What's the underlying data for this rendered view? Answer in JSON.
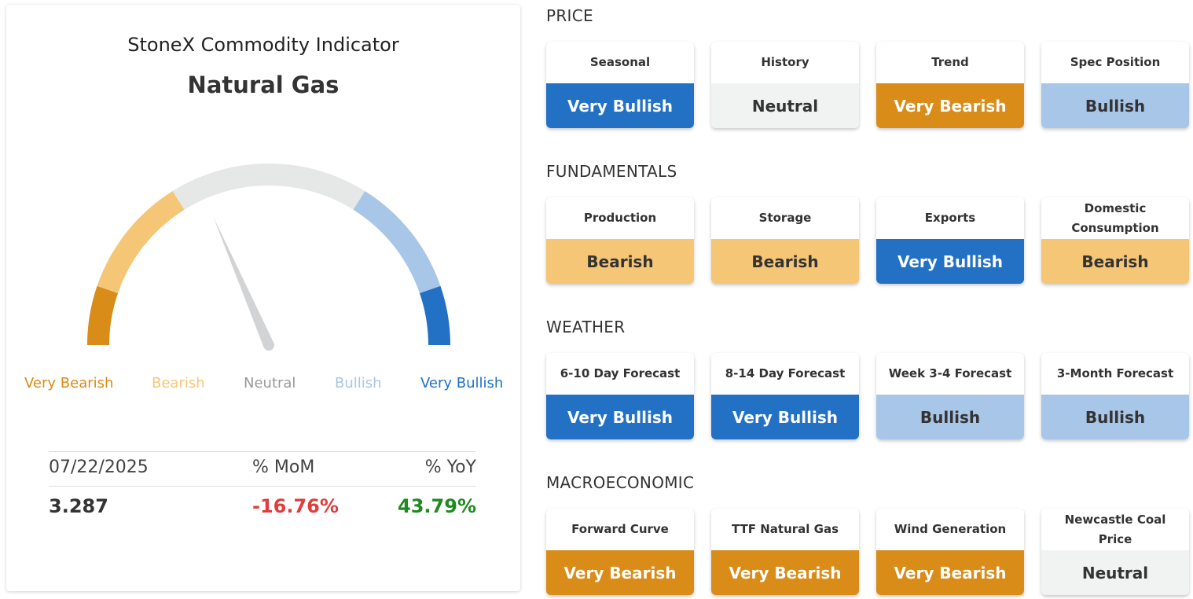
{
  "indicator": {
    "title": "StoneX Commodity Indicator",
    "commodity": "Natural Gas"
  },
  "gauge": {
    "needle_level": 0.37,
    "scale": [
      {
        "label": "Very Bearish",
        "color": "#d98c18"
      },
      {
        "label": "Bearish",
        "color": "#f6c677"
      },
      {
        "label": "Neutral",
        "color": "#999999"
      },
      {
        "label": "Bullish",
        "color": "#a8c6e7"
      },
      {
        "label": "Very Bullish",
        "color": "#2271c5"
      }
    ],
    "track_color": "#e6e7e7",
    "needle_color": "#d1d3d4"
  },
  "stats": {
    "date": "07/22/2025",
    "mom_header": "% MoM",
    "yoy_header": "% YoY",
    "price": "3.287",
    "mom_value": "-16.76%",
    "yoy_value": "43.79%",
    "mom_color": "#e03c3c",
    "yoy_color": "#1f8a1f"
  },
  "sections": [
    {
      "title": "PRICE",
      "tiles": [
        {
          "label": "Seasonal",
          "rating": "Very Bullish",
          "level": "vbull"
        },
        {
          "label": "History",
          "rating": "Neutral",
          "level": "neutral"
        },
        {
          "label": "Trend",
          "rating": "Very Bearish",
          "level": "vbear"
        },
        {
          "label": "Spec Position",
          "rating": "Bullish",
          "level": "bull"
        }
      ]
    },
    {
      "title": "FUNDAMENTALS",
      "tiles": [
        {
          "label": "Production",
          "rating": "Bearish",
          "level": "bear"
        },
        {
          "label": "Storage",
          "rating": "Bearish",
          "level": "bear"
        },
        {
          "label": "Exports",
          "rating": "Very Bullish",
          "level": "vbull"
        },
        {
          "label": "Domestic Consumption",
          "rating": "Bearish",
          "level": "bear"
        }
      ]
    },
    {
      "title": "WEATHER",
      "tiles": [
        {
          "label": "6-10 Day Forecast",
          "rating": "Very Bullish",
          "level": "vbull"
        },
        {
          "label": "8-14 Day Forecast",
          "rating": "Very Bullish",
          "level": "vbull"
        },
        {
          "label": "Week 3-4 Forecast",
          "rating": "Bullish",
          "level": "bull"
        },
        {
          "label": "3-Month Forecast",
          "rating": "Bullish",
          "level": "bull"
        }
      ]
    },
    {
      "title": "MACROECONOMIC",
      "tiles": [
        {
          "label": "Forward Curve",
          "rating": "Very Bearish",
          "level": "vbear"
        },
        {
          "label": "TTF Natural Gas",
          "rating": "Very Bearish",
          "level": "vbear"
        },
        {
          "label": "Wind Generation",
          "rating": "Very Bearish",
          "level": "vbear"
        },
        {
          "label": "Newcastle Coal Price",
          "rating": "Neutral",
          "level": "neutral"
        }
      ]
    }
  ]
}
